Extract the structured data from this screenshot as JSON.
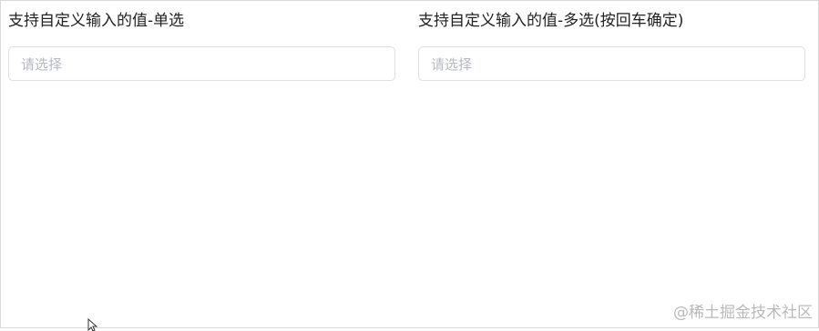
{
  "fields": [
    {
      "label": "支持自定义输入的值-单选",
      "placeholder": "请选择"
    },
    {
      "label": "支持自定义输入的值-多选(按回车确定)",
      "placeholder": "请选择"
    }
  ],
  "watermark": "@稀土掘金技术社区",
  "colors": {
    "border": "#dcdfe6",
    "placeholder": "#b6b9c0",
    "label": "#222222",
    "watermark": "#b9b9b9"
  },
  "icons": {
    "cursor": "mouse-pointer-icon"
  }
}
